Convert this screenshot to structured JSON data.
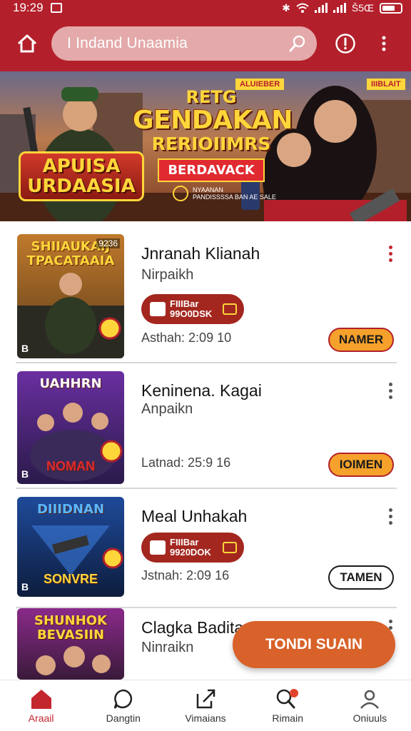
{
  "status_bar": {
    "time": "19:29",
    "right_text": "Š5Œ"
  },
  "app_bar": {
    "search_value": "I Indand Unaamia",
    "icons": {
      "home": "home-icon",
      "search": "search-icon",
      "alert": "alert-icon",
      "menu": "more-vertical-icon"
    }
  },
  "banner": {
    "title_top": "RETG",
    "title_main": "GENDAKAN",
    "title_sub": "RERIOIIMRS",
    "ribbon": "BERDAVACK",
    "left_logo_line1": "APUISA",
    "left_logo_line2": "URDAASIA",
    "tag_left": "ALUIEBER",
    "tag_right": "IIIBLAIT",
    "sponsor_line1": "NYAANAN",
    "sponsor_line2": "PANDISSSSA BAN AE SALE"
  },
  "items": [
    {
      "title": "Jnranah Klianah",
      "subtitle": "Nirpaikh",
      "price_line1": "FIIIBar",
      "price_line2": "99O0DSK",
      "date": "Asthah: 2:09 10",
      "action": "NAMER",
      "thumb_title": "SHIIAUKAIJ TPACATAAIA",
      "thumb_code": "9236",
      "thumb_b": "B",
      "thumb_sub": "",
      "thumb_colors": [
        "#c07a2c",
        "#5a3a1a"
      ]
    },
    {
      "title": "Keninena. Kagai",
      "subtitle": "Anpaikn",
      "price_line1": "",
      "price_line2": "",
      "date": "Latnad: 25:9 16",
      "action": "IOIMEN",
      "thumb_title": "UAHHRN",
      "thumb_code": "",
      "thumb_b": "B",
      "thumb_sub": "NOMAN",
      "thumb_colors": [
        "#6a2fa0",
        "#2a1a4a"
      ]
    },
    {
      "title": "Meal Unhakah",
      "subtitle": "",
      "price_line1": "FIIIBar",
      "price_line2": "9920DOK",
      "date": "Jstnah: 2:09 16",
      "action": "TAMEN",
      "thumb_title": "DIIIDNAN",
      "thumb_code": "",
      "thumb_b": "B",
      "thumb_sub": "SONVRE",
      "thumb_colors": [
        "#1f4a9a",
        "#0d1d3d"
      ]
    },
    {
      "title": "Clagka Badita",
      "subtitle": "Ninraikn",
      "price_line1": "",
      "price_line2": "",
      "date": "",
      "action": "",
      "thumb_title": "SHUNHOK BEVASIIN",
      "thumb_code": "",
      "thumb_b": "",
      "thumb_sub": "",
      "thumb_colors": [
        "#8a2a8a",
        "#3a1a3a"
      ]
    }
  ],
  "fab": {
    "label": "TONDI SUAIN"
  },
  "bottom_nav": [
    {
      "label": "Araail",
      "icon": "home-icon",
      "active": true
    },
    {
      "label": "Dangtin",
      "icon": "chat-icon",
      "active": false
    },
    {
      "label": "Vimaians",
      "icon": "share-icon",
      "active": false
    },
    {
      "label": "Rimain",
      "icon": "search-notification-icon",
      "active": false
    },
    {
      "label": "Oniuuls",
      "icon": "profile-icon",
      "active": false
    }
  ],
  "colors": {
    "primary": "#b3202b",
    "accent": "#f5a12b",
    "fab": "#d8622a"
  }
}
